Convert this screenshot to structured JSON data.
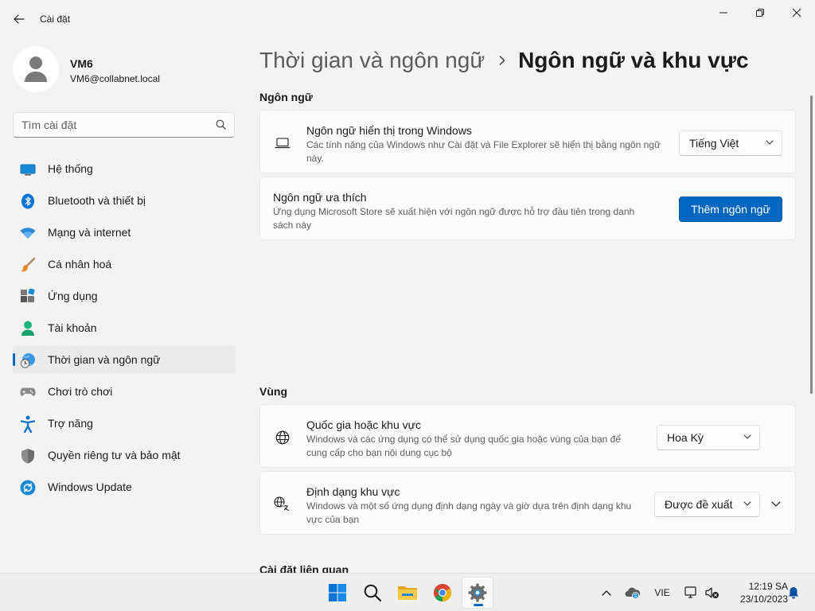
{
  "window": {
    "title": "Cài đặt"
  },
  "profile": {
    "name": "VM6",
    "email": "VM6@collabnet.local"
  },
  "search": {
    "placeholder": "Tìm cài đặt"
  },
  "sidebar": {
    "items": [
      {
        "label": "Hệ thống",
        "icon": "system-icon"
      },
      {
        "label": "Bluetooth và thiết bị",
        "icon": "bluetooth-icon"
      },
      {
        "label": "Mạng và internet",
        "icon": "wifi-icon"
      },
      {
        "label": "Cá nhân hoá",
        "icon": "brush-icon"
      },
      {
        "label": "Ứng dụng",
        "icon": "apps-icon"
      },
      {
        "label": "Tài khoản",
        "icon": "account-icon"
      },
      {
        "label": "Thời gian và ngôn ngữ",
        "icon": "time-language-icon",
        "active": true
      },
      {
        "label": "Chơi trò chơi",
        "icon": "gamepad-icon"
      },
      {
        "label": "Trợ năng",
        "icon": "accessibility-icon"
      },
      {
        "label": "Quyền riêng tư và bảo mật",
        "icon": "shield-icon"
      },
      {
        "label": "Windows Update",
        "icon": "update-icon"
      }
    ]
  },
  "breadcrumb": {
    "parent": "Thời gian và ngôn ngữ",
    "current": "Ngôn ngữ và khu vực"
  },
  "language_section": {
    "title": "Ngôn ngữ",
    "display_language": {
      "title": "Ngôn ngữ hiển thị trong Windows",
      "description": "Các tính năng của Windows như Cài đặt và File Explorer sẽ hiển thị bằng ngôn ngữ này.",
      "value": "Tiếng Việt"
    },
    "preferred_language": {
      "title": "Ngôn ngữ ưa thích",
      "description": "Ứng dụng Microsoft Store sẽ xuất hiện với ngôn ngữ được hỗ trợ đầu tiên trong danh sách này",
      "button_label": "Thêm ngôn ngữ"
    }
  },
  "region_section": {
    "title": "Vùng",
    "country": {
      "title": "Quốc gia hoặc khu vực",
      "description": "Windows và các ứng dụng có thể sử dụng quốc gia hoặc vùng của bạn để cung cấp cho bạn nội dung cục bộ",
      "value": "Hoa Kỳ"
    },
    "regional_format": {
      "title": "Định dạng khu vực",
      "description": "Windows và một số ứng dụng định dạng ngày và giờ dựa trên định dạng khu vực của bạn",
      "value": "Được đề xuất"
    }
  },
  "related_section": {
    "title": "Cài đặt liên quan"
  },
  "taskbar": {
    "apps": [
      "windows-start-icon",
      "search-icon",
      "file-explorer-icon",
      "chrome-icon",
      "settings-icon"
    ],
    "language": "VIE",
    "time": "12:19 SA",
    "date": "23/10/2023"
  },
  "colors": {
    "accent": "#0067c0",
    "background": "#f3f3f3",
    "card": "#fbfbfb"
  }
}
